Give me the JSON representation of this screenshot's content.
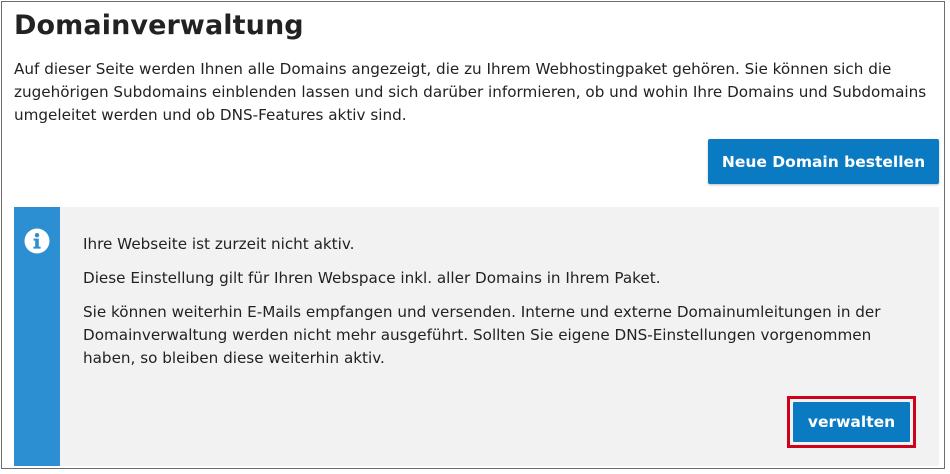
{
  "page": {
    "title": "Domainverwaltung",
    "intro": "Auf dieser Seite werden Ihnen alle Domains angezeigt, die zu Ihrem Webhostingpaket gehören. Sie können sich die zugehörigen Subdomains einblenden lassen und sich darüber informieren, ob und wohin Ihre Domains und Subdomains umgeleitet werden und ob DNS-Features aktiv sind."
  },
  "actions": {
    "order_domain_label": "Neue Domain bestellen"
  },
  "notice": {
    "icon": "info-icon",
    "line1": "Ihre Webseite ist zurzeit nicht aktiv.",
    "line2": "Diese Einstellung gilt für Ihren Webspace inkl. aller Domains in Ihrem Paket.",
    "line3": "Sie können weiterhin E-Mails empfangen und versenden. Interne und externe Domainumleitungen in der Domainverwaltung werden nicht mehr ausgeführt. Sollten Sie eigene DNS-Einstellungen vorgenommen haben, so bleiben diese weiterhin aktiv.",
    "manage_label": "verwalten"
  },
  "colors": {
    "primary_button": "#0a7bc2",
    "notice_bar": "#2b8fd1",
    "notice_background": "#f2f2f2",
    "highlight": "#d0021b"
  }
}
